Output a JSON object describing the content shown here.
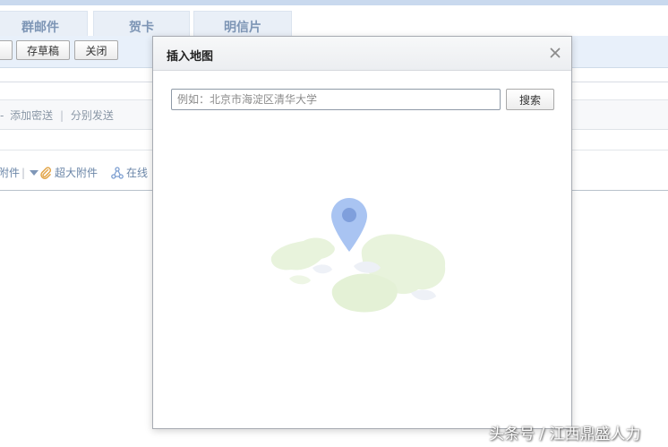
{
  "tabs": [
    {
      "label": "群邮件"
    },
    {
      "label": "贺卡"
    },
    {
      "label": "明信片"
    }
  ],
  "toolbar": {
    "draft_label": "存草稿",
    "close_label": "关闭"
  },
  "recipient": {
    "add_cc_label": "添加密送",
    "send_separately_label": "分别发送",
    "separator": "|",
    "prefix": "-"
  },
  "attachments": {
    "attach_label": "附件",
    "large_attach_label": "超大附件",
    "online_label": "在线"
  },
  "dialog": {
    "title": "插入地图",
    "search_placeholder": "例如：北京市海淀区清华大学",
    "search_value": "",
    "search_button_label": "搜索"
  },
  "watermark": {
    "text": "头条号 / 江西鼎盛人力"
  },
  "icons": {
    "close": "close-icon",
    "map_pin": "map-pin-icon",
    "paperclip": "paperclip-icon",
    "share": "share-icon",
    "dropdown": "chevron-down-icon"
  },
  "colors": {
    "toolbar_bg": "#e8f0fa",
    "tab_text": "#7d95b5",
    "link_text": "#6b86a8",
    "pin": "#a9c4f2",
    "pin_dot": "#7f9fdc",
    "land": "#e8f3dc"
  }
}
